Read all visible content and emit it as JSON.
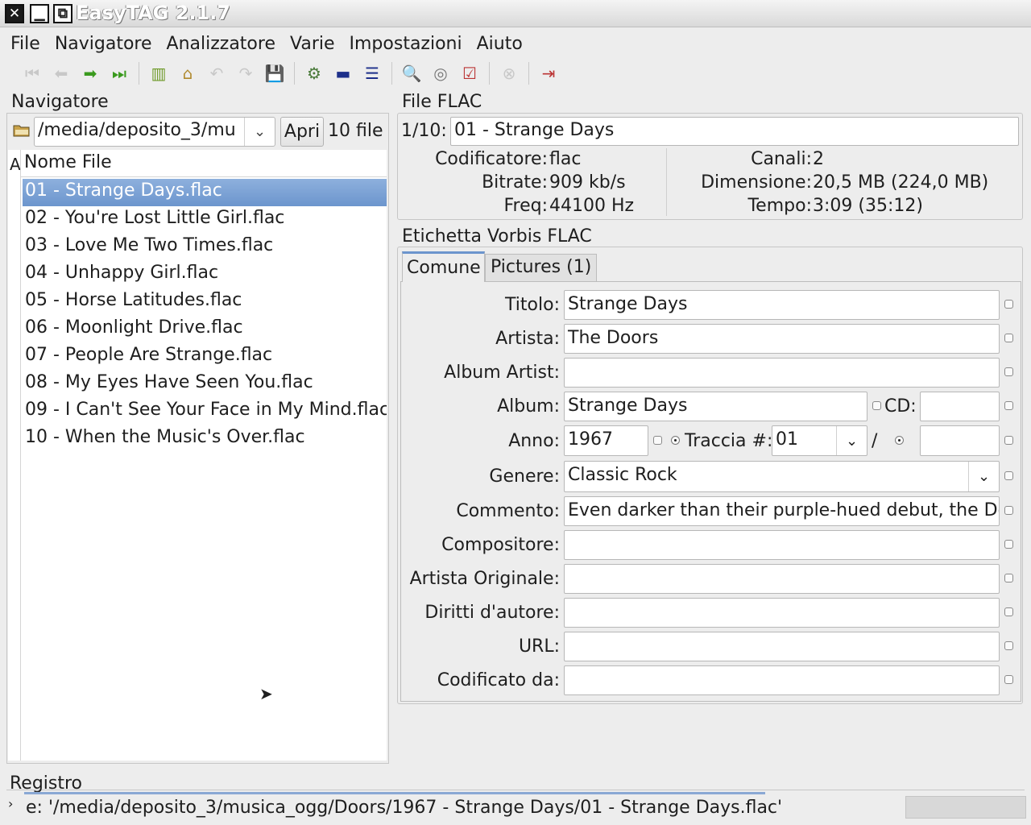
{
  "window": {
    "title": "EasyTAG 2.1.7"
  },
  "menu": [
    "File",
    "Navigatore",
    "Analizzatore",
    "Varie",
    "Impostazioni",
    "Aiuto"
  ],
  "toolbar": {
    "icons": [
      "first-icon",
      "prev-icon",
      "next-icon",
      "last-icon",
      "sep",
      "select-all-icon",
      "clean-icon",
      "undo-icon",
      "redo-icon",
      "save-icon",
      "sep",
      "scan-icon",
      "view-tree-icon",
      "view-list-icon",
      "sep",
      "search-icon",
      "cddb-icon",
      "playlist-icon",
      "sep",
      "stop-icon",
      "sep",
      "quit-icon"
    ]
  },
  "browser": {
    "label": "Navigatore",
    "path": "/media/deposito_3/mu",
    "open_label": "Apri",
    "file_count": "10 file",
    "col_artist_clip": "A",
    "column_header": "Nome File",
    "files": [
      "01 - Strange Days.flac",
      "02 - You're Lost Little Girl.flac",
      "03 - Love Me Two Times.flac",
      "04 - Unhappy Girl.flac",
      "05 - Horse Latitudes.flac",
      "06 - Moonlight Drive.flac",
      "07 - People Are Strange.flac",
      "08 - My Eyes Have Seen You.flac",
      "09 - I Can't See Your Face in My Mind.flac",
      "10 - When the Music's Over.flac"
    ],
    "selected_index": 0
  },
  "file_info": {
    "label": "File FLAC",
    "index": "1/10:",
    "name": "01 - Strange Days",
    "encoder_k": "Codificatore:",
    "encoder_v": "flac",
    "bitrate_k": "Bitrate:",
    "bitrate_v": "909 kb/s",
    "freq_k": "Freq:",
    "freq_v": "44100 Hz",
    "channels_k": "Canali:",
    "channels_v": "2",
    "size_k": "Dimensione:",
    "size_v": "20,5 MB (224,0 MB)",
    "time_k": "Tempo:",
    "time_v": "3:09 (35:12)"
  },
  "tag": {
    "label": "Etichetta Vorbis FLAC",
    "tabs": [
      "Comune",
      "Pictures (1)"
    ],
    "title_l": "Titolo:",
    "title_v": "Strange Days",
    "artist_l": "Artista:",
    "artist_v": "The Doors",
    "album_artist_l": "Album Artist:",
    "album_artist_v": "",
    "album_l": "Album:",
    "album_v": "Strange Days",
    "cd_l": "CD:",
    "cd_v": "",
    "year_l": "Anno:",
    "year_v": "1967",
    "track_l": "Traccia #:",
    "track_v": "01",
    "track_sep": "/",
    "track_total_v": "",
    "genre_l": "Genere:",
    "genre_v": "Classic Rock",
    "comment_l": "Commento:",
    "comment_v": "Even darker than their purple-hued debut, the Do",
    "composer_l": "Compositore:",
    "composer_v": "",
    "orig_artist_l": "Artista Originale:",
    "orig_artist_v": "",
    "copyright_l": "Diritti d'autore:",
    "copyright_v": "",
    "url_l": "URL:",
    "url_v": "",
    "encoded_by_l": "Codificato da:",
    "encoded_by_v": ""
  },
  "log": {
    "label": "Registro",
    "text": "e: '/media/deposito_3/musica_ogg/Doors/1967 - Strange Days/01 - Strange Days.flac'"
  }
}
